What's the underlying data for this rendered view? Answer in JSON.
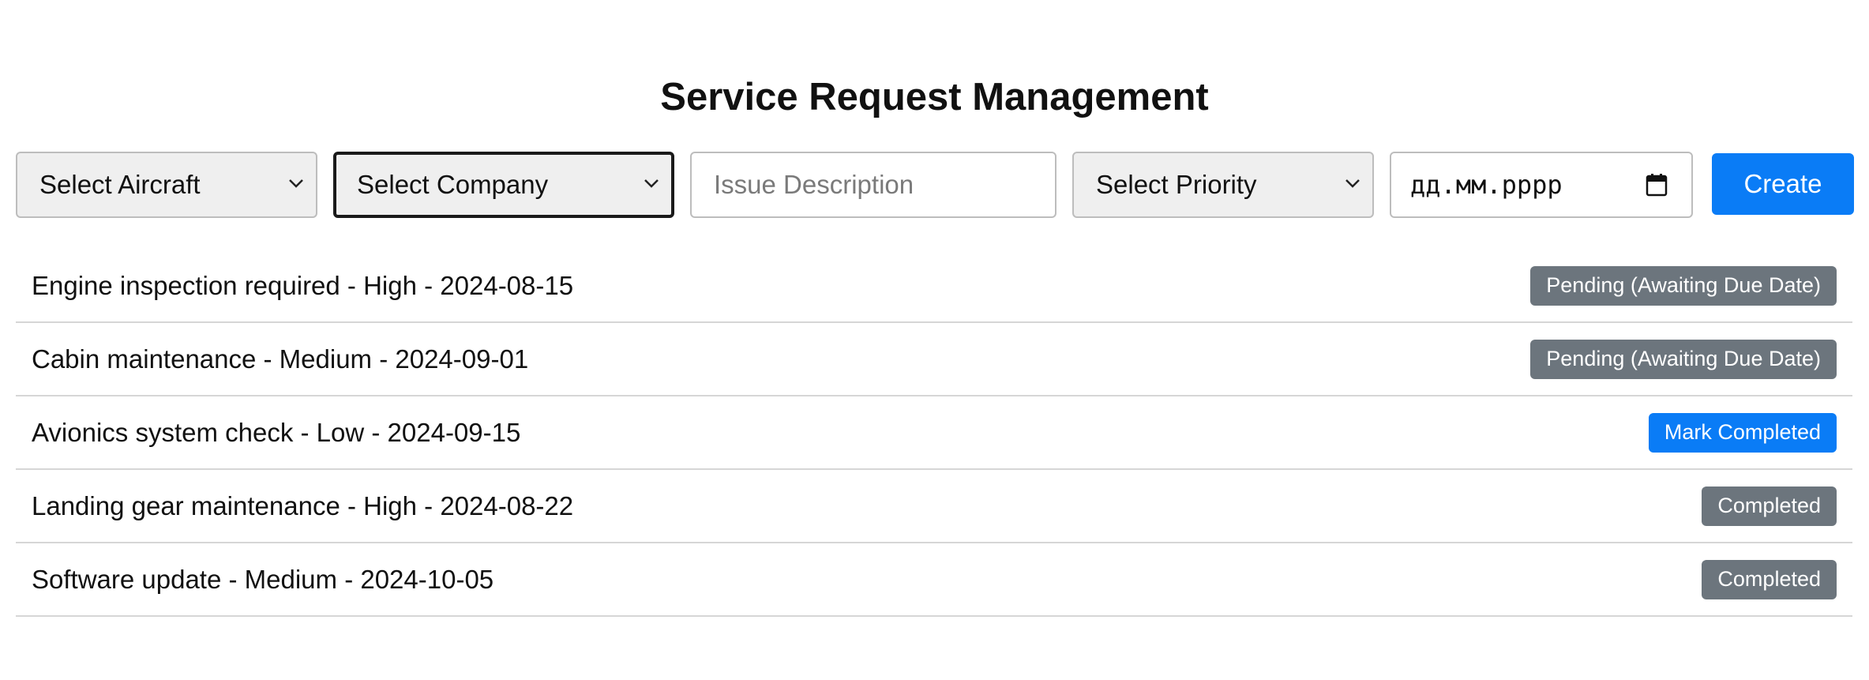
{
  "header": {
    "title": "Service Request Management"
  },
  "form": {
    "aircraft_select": "Select Aircraft",
    "company_select": "Select Company",
    "issue_placeholder": "Issue Description",
    "priority_select": "Select Priority",
    "date_placeholder": "дд.мм.рррр",
    "create_label": "Create"
  },
  "requests": [
    {
      "text": "Engine inspection required - High - 2024-08-15",
      "status": "Pending (Awaiting Due Date)",
      "kind": "pending"
    },
    {
      "text": "Cabin maintenance - Medium - 2024-09-01",
      "status": "Pending (Awaiting Due Date)",
      "kind": "pending"
    },
    {
      "text": "Avionics system check - Low - 2024-09-15",
      "status": "Mark Completed",
      "kind": "action"
    },
    {
      "text": "Landing gear maintenance - High - 2024-08-22",
      "status": "Completed",
      "kind": "completed"
    },
    {
      "text": "Software update - Medium - 2024-10-05",
      "status": "Completed",
      "kind": "completed"
    }
  ],
  "colors": {
    "primary": "#0a7cf6",
    "badge_gray": "#6c757d",
    "select_bg": "#efefef"
  }
}
